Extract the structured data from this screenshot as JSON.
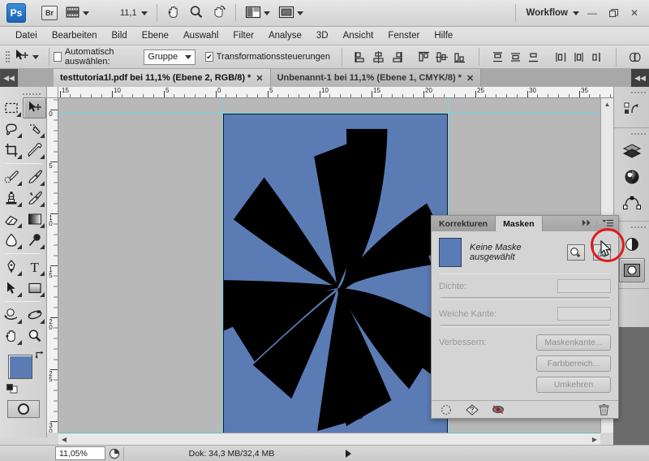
{
  "app": {
    "logo_text": "Ps",
    "bridge_label": "Br",
    "mini_bridge_icon": "mini-bridge-icon",
    "zoom_level": "11,1",
    "hand_icon": "hand-icon",
    "zoom_icon": "magnifier-icon",
    "rotate_view_icon": "rotate-view-icon",
    "arrange_documents_icon": "arrange-documents-icon",
    "screen_mode_icon": "screen-mode-icon",
    "workspace_label": "Workflow",
    "minimize": "—",
    "restore": "❐",
    "close": "✕"
  },
  "menu": {
    "items": [
      "Datei",
      "Bearbeiten",
      "Bild",
      "Ebene",
      "Auswahl",
      "Filter",
      "Analyse",
      "3D",
      "Ansicht",
      "Fenster",
      "Hilfe"
    ]
  },
  "options_bar": {
    "tool_icon": "move-tool-icon",
    "auto_select_label": "Automatisch auswählen:",
    "auto_select_checked": false,
    "group_value": "Gruppe",
    "transform_controls_label": "Transformationssteuerungen",
    "transform_controls_checked": true,
    "align_buttons": [
      "align-left-edges",
      "align-horizontal-centers",
      "align-right-edges",
      "align-top-edges",
      "align-vertical-centers",
      "align-bottom-edges",
      "distribute-top-edges",
      "distribute-vertical-centers",
      "distribute-bottom-edges",
      "distribute-left-edges",
      "distribute-horizontal-centers",
      "distribute-right-edges",
      "auto-align-layers"
    ]
  },
  "tabs": {
    "items": [
      {
        "label": "testtutoria1l.pdf bei 11,1% (Ebene 2, RGB/8) *",
        "active": true,
        "close": "✕"
      },
      {
        "label": "Unbenannt-1 bei 11,1% (Ebene 1, CMYK/8) *",
        "active": false,
        "close": "✕"
      }
    ]
  },
  "toolbox": {
    "tools": [
      {
        "name": "rectangular-marquee-tool",
        "glyph": "marquee",
        "active": false,
        "has_flyout": true
      },
      {
        "name": "move-tool",
        "glyph": "move",
        "active": true,
        "has_flyout": false
      },
      {
        "name": "lasso-tool",
        "glyph": "lasso",
        "active": false,
        "has_flyout": true
      },
      {
        "name": "quick-selection-tool",
        "glyph": "magicwand",
        "active": false,
        "has_flyout": true
      },
      {
        "name": "crop-tool",
        "glyph": "crop",
        "active": false,
        "has_flyout": true
      },
      {
        "name": "eyedropper-tool",
        "glyph": "eyedropper",
        "active": false,
        "has_flyout": true
      },
      {
        "name": "spot-healing-brush-tool",
        "glyph": "healing",
        "active": false,
        "has_flyout": true
      },
      {
        "name": "brush-tool",
        "glyph": "brush",
        "active": false,
        "has_flyout": true
      },
      {
        "name": "clone-stamp-tool",
        "glyph": "stamp",
        "active": false,
        "has_flyout": true
      },
      {
        "name": "history-brush-tool",
        "glyph": "historybrush",
        "active": false,
        "has_flyout": true
      },
      {
        "name": "eraser-tool",
        "glyph": "eraser",
        "active": false,
        "has_flyout": true
      },
      {
        "name": "gradient-tool",
        "glyph": "gradient",
        "active": false,
        "has_flyout": true
      },
      {
        "name": "blur-tool",
        "glyph": "blur",
        "active": false,
        "has_flyout": true
      },
      {
        "name": "dodge-tool",
        "glyph": "dodge",
        "active": false,
        "has_flyout": true
      },
      {
        "name": "pen-tool",
        "glyph": "pen",
        "active": false,
        "has_flyout": true
      },
      {
        "name": "type-tool",
        "glyph": "type",
        "active": false,
        "has_flyout": true
      },
      {
        "name": "path-selection-tool",
        "glyph": "pathselect",
        "active": false,
        "has_flyout": true
      },
      {
        "name": "rectangle-tool",
        "glyph": "rectangle",
        "active": false,
        "has_flyout": true
      },
      {
        "name": "3d-rotate-tool",
        "glyph": "rotate3d",
        "active": false,
        "has_flyout": true
      },
      {
        "name": "3d-orbit-camera-tool",
        "glyph": "orbit3d",
        "active": false,
        "has_flyout": true
      },
      {
        "name": "hand-tool",
        "glyph": "hand",
        "active": false,
        "has_flyout": true
      },
      {
        "name": "zoom-tool",
        "glyph": "zoom",
        "active": false,
        "has_flyout": false
      }
    ],
    "foreground_color": "#5b7bb5",
    "background_color": "#ffffff",
    "quick_mask_icon": "quick-mask-icon"
  },
  "rulers": {
    "unit": "cm",
    "horizontal_labels": [
      "15",
      "10",
      "5",
      "0",
      "5",
      "10",
      "15",
      "20",
      "25",
      "30",
      "35"
    ],
    "vertical_labels": [
      "0",
      "5",
      "10",
      "15",
      "20",
      "25",
      "30"
    ]
  },
  "canvas": {
    "background_color": "#b8b8b8",
    "artboard_color": "#5b7bb5",
    "shape_color": "#000000",
    "guide_color": "#6fd9e8",
    "artwork_name": "black-swirl-rays"
  },
  "right_dock": {
    "groups": [
      {
        "icons": [
          {
            "name": "history-panel-icon",
            "active": false
          }
        ]
      },
      {
        "icons": [
          {
            "name": "layers-panel-icon",
            "active": false
          },
          {
            "name": "channels-panel-icon",
            "active": false
          },
          {
            "name": "paths-panel-icon",
            "active": false
          }
        ]
      },
      {
        "icons": [
          {
            "name": "adjustments-panel-icon",
            "active": false
          },
          {
            "name": "masks-panel-icon",
            "active": true
          }
        ]
      }
    ]
  },
  "masks_panel": {
    "tabs": [
      {
        "label": "Korrekturen",
        "active": false
      },
      {
        "label": "Masken",
        "active": true
      }
    ],
    "collapse_icon": "double-arrow-right-icon",
    "menu_icon": "panel-menu-icon",
    "thumbnail_color": "#5b7bb5",
    "status_text": "Keine Maske ausgewählt",
    "add_pixel_mask_icon": "add-pixel-mask-icon",
    "add_vector_mask_icon": "add-vector-mask-icon",
    "density": {
      "label": "Dichte:",
      "value": ""
    },
    "feather": {
      "label": "Weiche Kante:",
      "value": ""
    },
    "refine": {
      "label": "Verbessern:",
      "buttons": [
        "Maskenkante...",
        "Farbbereich...",
        "Umkehren"
      ]
    },
    "footer_icons": [
      "load-selection-icon",
      "apply-mask-icon",
      "disable-mask-icon",
      "delete-mask-icon"
    ]
  },
  "annotation": {
    "highlight_color": "#e01b1b",
    "highlight_target": "add-vector-mask-button",
    "cursor_icon": "mouse-cursor-icon"
  },
  "status_bar": {
    "zoom_value": "11,05%",
    "preview_icon": "proof-preview-icon",
    "doc_info": "Dok: 34,3 MB/32,4 MB",
    "expand_icon": "status-expand-arrow"
  },
  "scrollbars": {
    "h_left_arrow": "◀",
    "h_right_arrow": "▶",
    "v_up_arrow": "▲",
    "v_down_arrow": "▼"
  }
}
